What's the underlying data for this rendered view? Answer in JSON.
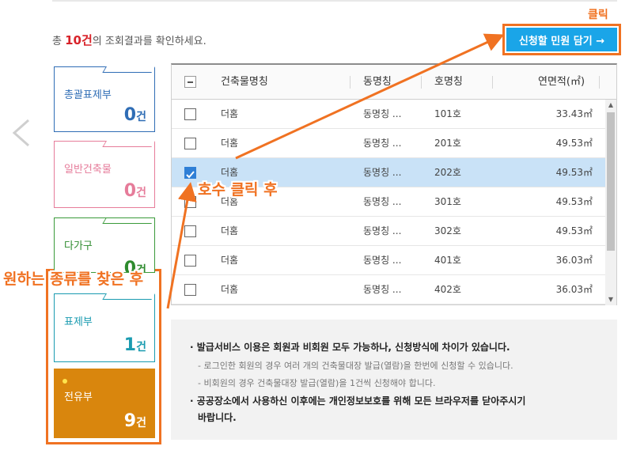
{
  "summary": {
    "prefix": "총 ",
    "count": "10건",
    "suffix": "의 조회결과를 확인하세요."
  },
  "add_button": {
    "label": "신청할 민원 담기 →"
  },
  "annotations": {
    "click": "클릭",
    "after_room": "호수 클릭 후",
    "after_type": "원하는 종류를 찾은 후"
  },
  "categories": [
    {
      "label": "총괄표제부",
      "num": "0",
      "unit": "건"
    },
    {
      "label": "일반건축물",
      "num": "0",
      "unit": "건"
    },
    {
      "label": "다가구",
      "num": "0",
      "unit": "건"
    },
    {
      "label": "표제부",
      "num": "1",
      "unit": "건"
    },
    {
      "label": "전유부",
      "num": "9",
      "unit": "건"
    }
  ],
  "table": {
    "headers": [
      "건축물명칭",
      "동명칭",
      "호명칭",
      "연면적(㎡)"
    ],
    "rows": [
      {
        "name": "더홈",
        "dong": "동명칭 ...",
        "ho": "101호",
        "area": "33.43㎡",
        "checked": false
      },
      {
        "name": "더홈",
        "dong": "동명칭 ...",
        "ho": "201호",
        "area": "49.53㎡",
        "checked": false
      },
      {
        "name": "더홈",
        "dong": "동명칭 ...",
        "ho": "202호",
        "area": "49.53㎡",
        "checked": true
      },
      {
        "name": "더홈",
        "dong": "동명칭 ...",
        "ho": "301호",
        "area": "49.53㎡",
        "checked": false
      },
      {
        "name": "더홈",
        "dong": "동명칭 ...",
        "ho": "302호",
        "area": "49.53㎡",
        "checked": false
      },
      {
        "name": "더홈",
        "dong": "동명칭 ...",
        "ho": "401호",
        "area": "36.03㎡",
        "checked": false
      },
      {
        "name": "더홈",
        "dong": "동명칭 ...",
        "ho": "402호",
        "area": "36.03㎡",
        "checked": false
      }
    ]
  },
  "notice": {
    "main1": "· 발급서비스 이용은 회원과 비회원 모두 가능하나, 신청방식에 차이가 있습니다.",
    "sub1": "- 로그인한 회원의 경우 여러 개의 건축물대장 발급(열람)을 한번에 신청할 수 있습니다.",
    "sub2": "- 비회원의 경우 건축물대장 발급(열람)을 1건씩 신청해야 합니다.",
    "main2a": "· 공공장소에서 사용하신 이후에는 개인정보보호를 위해 모든 브라우저를 닫아주시기",
    "main2b": "바랍니다."
  },
  "colors": {
    "accent": "#f07222",
    "button": "#1aa5e8",
    "selected_row": "#c9e2f7",
    "jeonyu": "#d9860d"
  }
}
